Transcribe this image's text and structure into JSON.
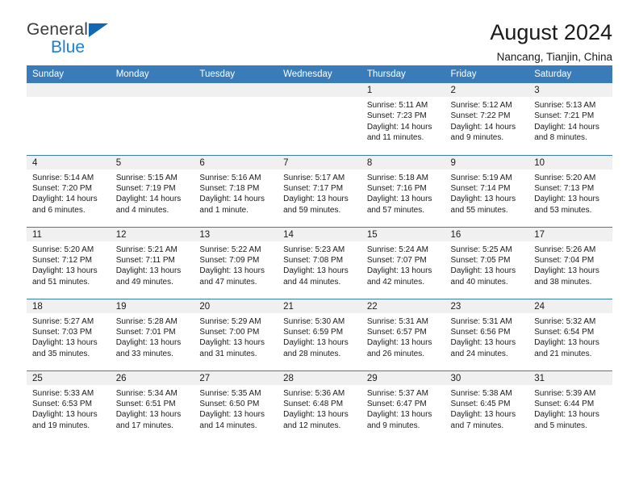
{
  "logo": {
    "word1": "General",
    "word2": "Blue",
    "triangle_color": "#1268b3",
    "blue_text_color": "#1b7fd4"
  },
  "header": {
    "title": "August 2024",
    "subtitle": "Nancang, Tianjin, China"
  },
  "theme": {
    "header_bg": "#3a7cba",
    "header_text": "#ffffff",
    "daynum_bg": "#f0f0f0",
    "cell_bg": "#ffffff",
    "row_divider": "#3a7cba"
  },
  "calendar": {
    "weekday_headers": [
      "Sunday",
      "Monday",
      "Tuesday",
      "Wednesday",
      "Thursday",
      "Friday",
      "Saturday"
    ],
    "labels": {
      "sunrise_prefix": "Sunrise:",
      "sunset_prefix": "Sunset:",
      "daylight_prefix": "Daylight:"
    },
    "weeks": [
      [
        {
          "day": "",
          "blank": true
        },
        {
          "day": "",
          "blank": true
        },
        {
          "day": "",
          "blank": true
        },
        {
          "day": "",
          "blank": true
        },
        {
          "day": "1",
          "sunrise": "Sunrise: 5:11 AM",
          "sunset": "Sunset: 7:23 PM",
          "daylight_line1": "Daylight: 14 hours",
          "daylight_line2": "and 11 minutes."
        },
        {
          "day": "2",
          "sunrise": "Sunrise: 5:12 AM",
          "sunset": "Sunset: 7:22 PM",
          "daylight_line1": "Daylight: 14 hours",
          "daylight_line2": "and 9 minutes."
        },
        {
          "day": "3",
          "sunrise": "Sunrise: 5:13 AM",
          "sunset": "Sunset: 7:21 PM",
          "daylight_line1": "Daylight: 14 hours",
          "daylight_line2": "and 8 minutes."
        }
      ],
      [
        {
          "day": "4",
          "sunrise": "Sunrise: 5:14 AM",
          "sunset": "Sunset: 7:20 PM",
          "daylight_line1": "Daylight: 14 hours",
          "daylight_line2": "and 6 minutes."
        },
        {
          "day": "5",
          "sunrise": "Sunrise: 5:15 AM",
          "sunset": "Sunset: 7:19 PM",
          "daylight_line1": "Daylight: 14 hours",
          "daylight_line2": "and 4 minutes."
        },
        {
          "day": "6",
          "sunrise": "Sunrise: 5:16 AM",
          "sunset": "Sunset: 7:18 PM",
          "daylight_line1": "Daylight: 14 hours",
          "daylight_line2": "and 1 minute."
        },
        {
          "day": "7",
          "sunrise": "Sunrise: 5:17 AM",
          "sunset": "Sunset: 7:17 PM",
          "daylight_line1": "Daylight: 13 hours",
          "daylight_line2": "and 59 minutes."
        },
        {
          "day": "8",
          "sunrise": "Sunrise: 5:18 AM",
          "sunset": "Sunset: 7:16 PM",
          "daylight_line1": "Daylight: 13 hours",
          "daylight_line2": "and 57 minutes."
        },
        {
          "day": "9",
          "sunrise": "Sunrise: 5:19 AM",
          "sunset": "Sunset: 7:14 PM",
          "daylight_line1": "Daylight: 13 hours",
          "daylight_line2": "and 55 minutes."
        },
        {
          "day": "10",
          "sunrise": "Sunrise: 5:20 AM",
          "sunset": "Sunset: 7:13 PM",
          "daylight_line1": "Daylight: 13 hours",
          "daylight_line2": "and 53 minutes."
        }
      ],
      [
        {
          "day": "11",
          "sunrise": "Sunrise: 5:20 AM",
          "sunset": "Sunset: 7:12 PM",
          "daylight_line1": "Daylight: 13 hours",
          "daylight_line2": "and 51 minutes."
        },
        {
          "day": "12",
          "sunrise": "Sunrise: 5:21 AM",
          "sunset": "Sunset: 7:11 PM",
          "daylight_line1": "Daylight: 13 hours",
          "daylight_line2": "and 49 minutes."
        },
        {
          "day": "13",
          "sunrise": "Sunrise: 5:22 AM",
          "sunset": "Sunset: 7:09 PM",
          "daylight_line1": "Daylight: 13 hours",
          "daylight_line2": "and 47 minutes."
        },
        {
          "day": "14",
          "sunrise": "Sunrise: 5:23 AM",
          "sunset": "Sunset: 7:08 PM",
          "daylight_line1": "Daylight: 13 hours",
          "daylight_line2": "and 44 minutes."
        },
        {
          "day": "15",
          "sunrise": "Sunrise: 5:24 AM",
          "sunset": "Sunset: 7:07 PM",
          "daylight_line1": "Daylight: 13 hours",
          "daylight_line2": "and 42 minutes."
        },
        {
          "day": "16",
          "sunrise": "Sunrise: 5:25 AM",
          "sunset": "Sunset: 7:05 PM",
          "daylight_line1": "Daylight: 13 hours",
          "daylight_line2": "and 40 minutes."
        },
        {
          "day": "17",
          "sunrise": "Sunrise: 5:26 AM",
          "sunset": "Sunset: 7:04 PM",
          "daylight_line1": "Daylight: 13 hours",
          "daylight_line2": "and 38 minutes."
        }
      ],
      [
        {
          "day": "18",
          "sunrise": "Sunrise: 5:27 AM",
          "sunset": "Sunset: 7:03 PM",
          "daylight_line1": "Daylight: 13 hours",
          "daylight_line2": "and 35 minutes."
        },
        {
          "day": "19",
          "sunrise": "Sunrise: 5:28 AM",
          "sunset": "Sunset: 7:01 PM",
          "daylight_line1": "Daylight: 13 hours",
          "daylight_line2": "and 33 minutes."
        },
        {
          "day": "20",
          "sunrise": "Sunrise: 5:29 AM",
          "sunset": "Sunset: 7:00 PM",
          "daylight_line1": "Daylight: 13 hours",
          "daylight_line2": "and 31 minutes."
        },
        {
          "day": "21",
          "sunrise": "Sunrise: 5:30 AM",
          "sunset": "Sunset: 6:59 PM",
          "daylight_line1": "Daylight: 13 hours",
          "daylight_line2": "and 28 minutes."
        },
        {
          "day": "22",
          "sunrise": "Sunrise: 5:31 AM",
          "sunset": "Sunset: 6:57 PM",
          "daylight_line1": "Daylight: 13 hours",
          "daylight_line2": "and 26 minutes."
        },
        {
          "day": "23",
          "sunrise": "Sunrise: 5:31 AM",
          "sunset": "Sunset: 6:56 PM",
          "daylight_line1": "Daylight: 13 hours",
          "daylight_line2": "and 24 minutes."
        },
        {
          "day": "24",
          "sunrise": "Sunrise: 5:32 AM",
          "sunset": "Sunset: 6:54 PM",
          "daylight_line1": "Daylight: 13 hours",
          "daylight_line2": "and 21 minutes."
        }
      ],
      [
        {
          "day": "25",
          "sunrise": "Sunrise: 5:33 AM",
          "sunset": "Sunset: 6:53 PM",
          "daylight_line1": "Daylight: 13 hours",
          "daylight_line2": "and 19 minutes."
        },
        {
          "day": "26",
          "sunrise": "Sunrise: 5:34 AM",
          "sunset": "Sunset: 6:51 PM",
          "daylight_line1": "Daylight: 13 hours",
          "daylight_line2": "and 17 minutes."
        },
        {
          "day": "27",
          "sunrise": "Sunrise: 5:35 AM",
          "sunset": "Sunset: 6:50 PM",
          "daylight_line1": "Daylight: 13 hours",
          "daylight_line2": "and 14 minutes."
        },
        {
          "day": "28",
          "sunrise": "Sunrise: 5:36 AM",
          "sunset": "Sunset: 6:48 PM",
          "daylight_line1": "Daylight: 13 hours",
          "daylight_line2": "and 12 minutes."
        },
        {
          "day": "29",
          "sunrise": "Sunrise: 5:37 AM",
          "sunset": "Sunset: 6:47 PM",
          "daylight_line1": "Daylight: 13 hours",
          "daylight_line2": "and 9 minutes."
        },
        {
          "day": "30",
          "sunrise": "Sunrise: 5:38 AM",
          "sunset": "Sunset: 6:45 PM",
          "daylight_line1": "Daylight: 13 hours",
          "daylight_line2": "and 7 minutes."
        },
        {
          "day": "31",
          "sunrise": "Sunrise: 5:39 AM",
          "sunset": "Sunset: 6:44 PM",
          "daylight_line1": "Daylight: 13 hours",
          "daylight_line2": "and 5 minutes."
        }
      ]
    ]
  }
}
